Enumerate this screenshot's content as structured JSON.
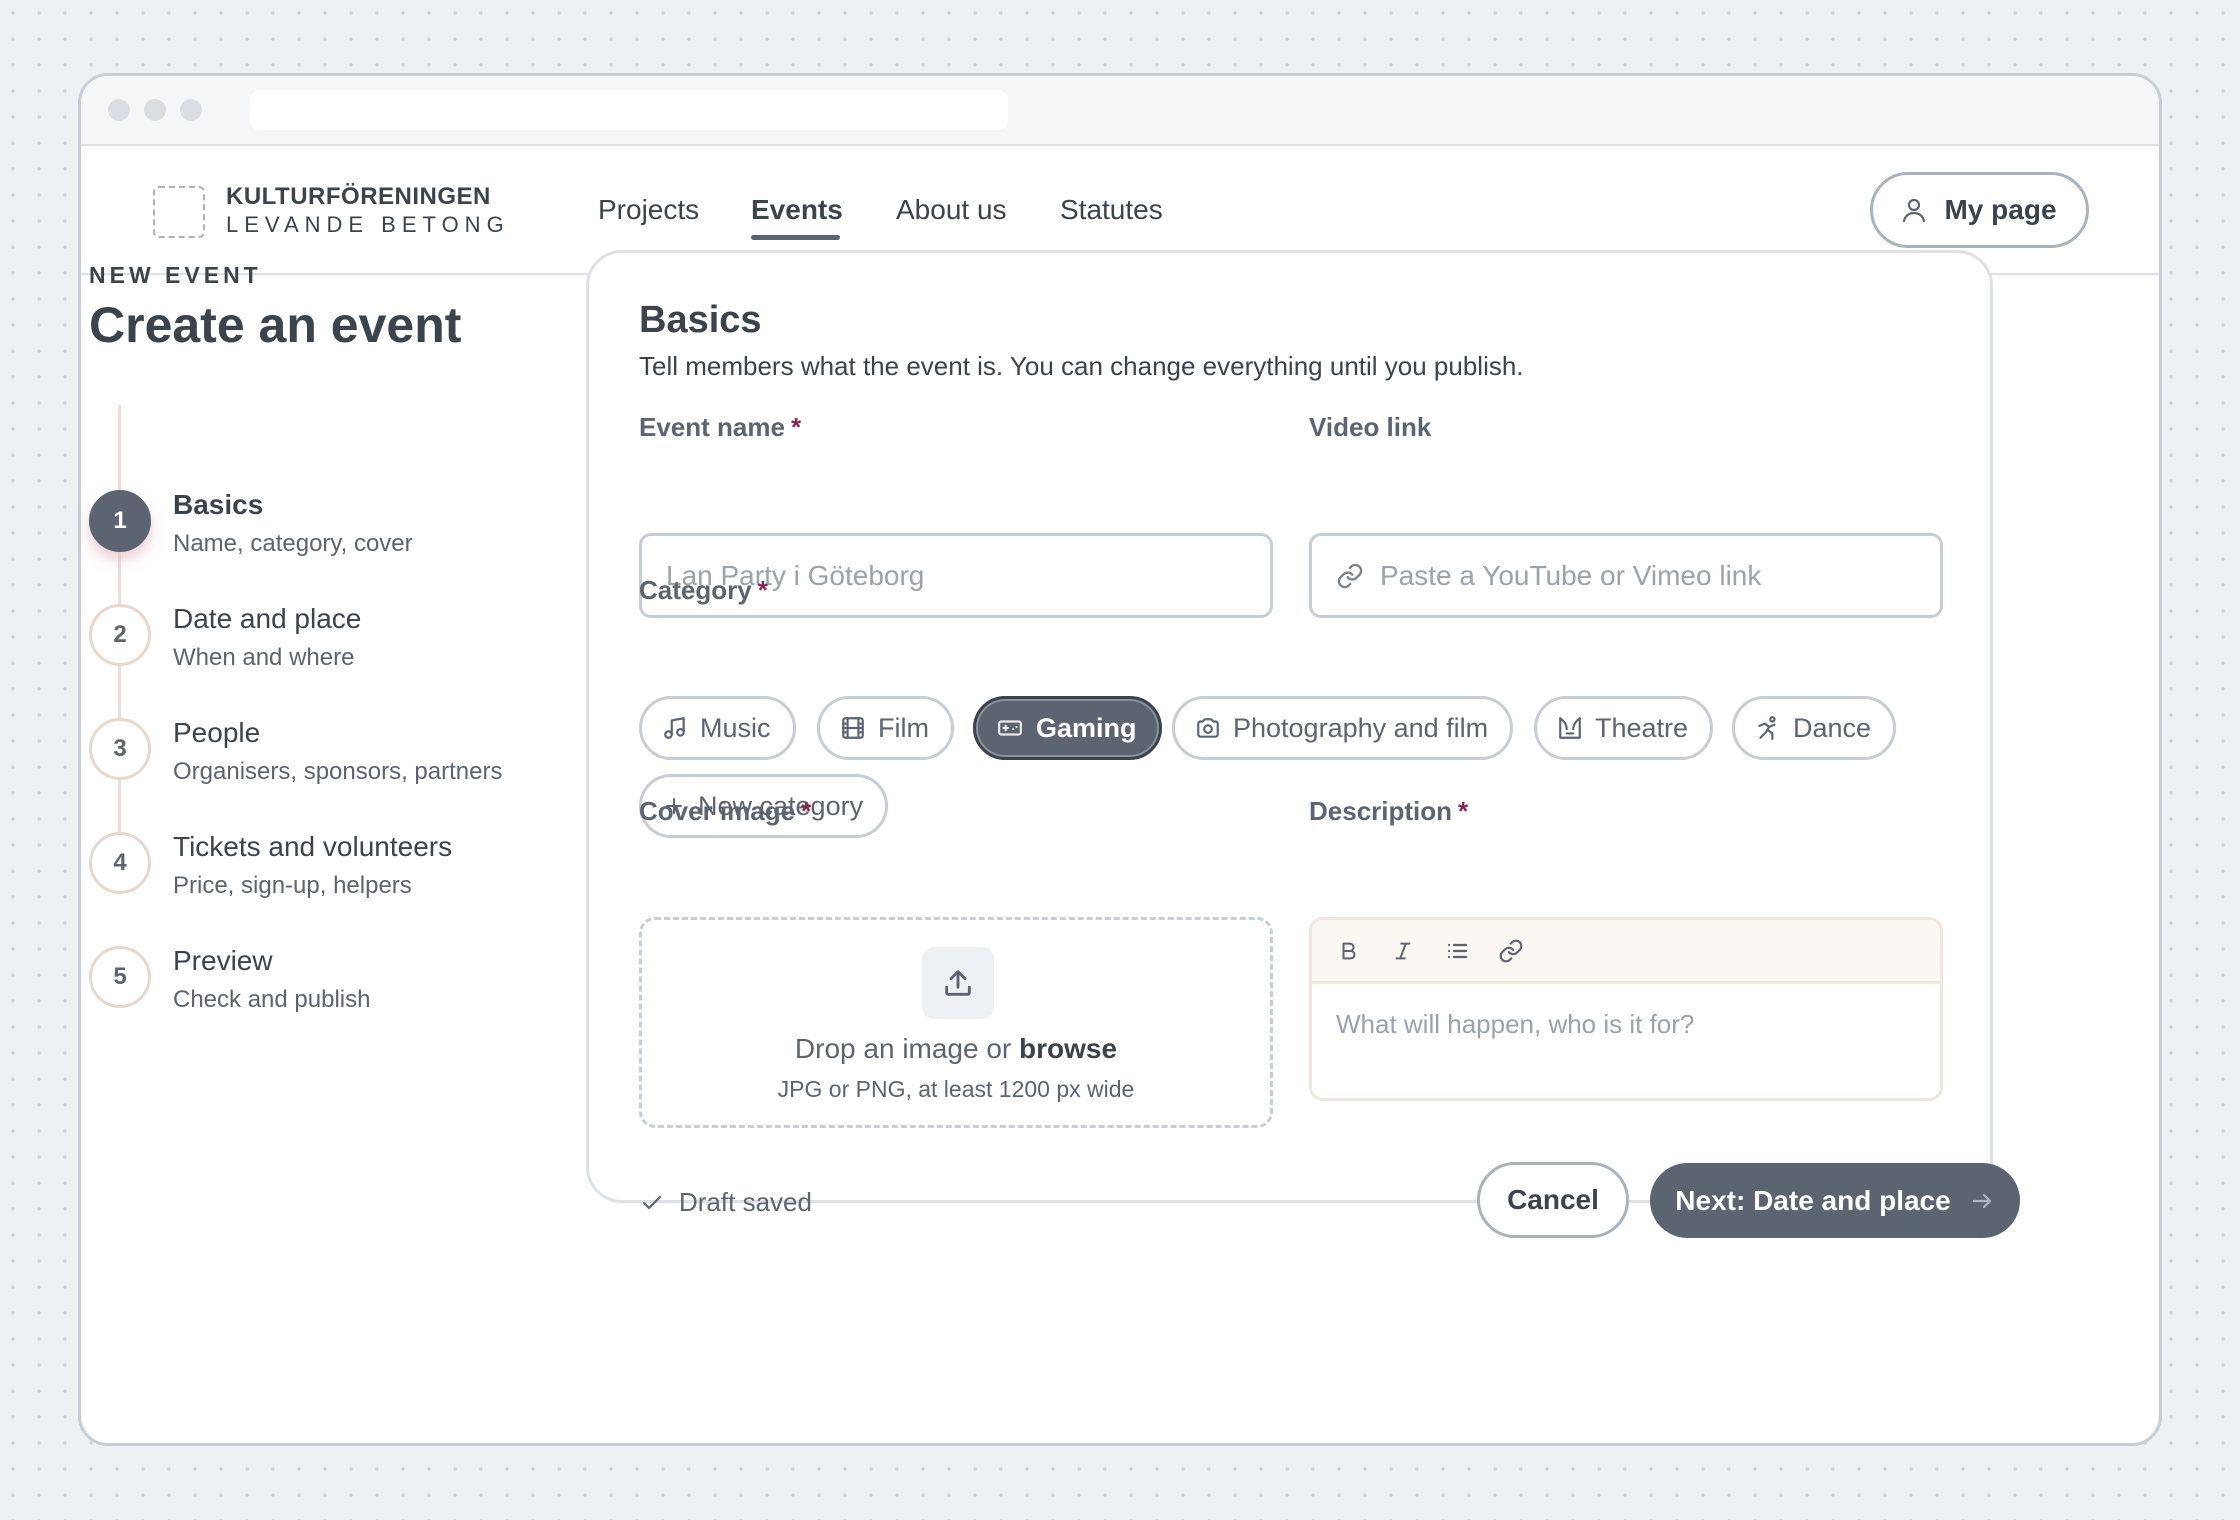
{
  "nav": {
    "logo_line1": "KULTURFÖRENINGEN",
    "logo_line2": "LEVANDE BETONG",
    "links": [
      {
        "label": "Projects",
        "active": false
      },
      {
        "label": "Events",
        "active": true
      },
      {
        "label": "About us",
        "active": false
      },
      {
        "label": "Statutes",
        "active": false
      }
    ],
    "my_page": "My page"
  },
  "page": {
    "eyebrow": "NEW EVENT",
    "title": "Create an event"
  },
  "steps": [
    {
      "number": "1",
      "title": "Basics",
      "subtitle": "Name, category, cover",
      "active": true
    },
    {
      "number": "2",
      "title": "Date and place",
      "subtitle": "When and where",
      "active": false
    },
    {
      "number": "3",
      "title": "People",
      "subtitle": "Organisers, sponsors, partners",
      "active": false
    },
    {
      "number": "4",
      "title": "Tickets and volunteers",
      "subtitle": "Price, sign-up, helpers",
      "active": false
    },
    {
      "number": "5",
      "title": "Preview",
      "subtitle": "Check and publish",
      "active": false
    }
  ],
  "form": {
    "title": "Basics",
    "subtitle": "Tell members what the event is. You can change everything until you publish.",
    "required_mark": "*",
    "event_name": {
      "label": "Event name",
      "placeholder": "Lan Party i Göteborg"
    },
    "video_link": {
      "label": "Video link",
      "placeholder": "Paste a YouTube or Vimeo link",
      "icon": "link-icon"
    },
    "category": {
      "label": "Category",
      "options": [
        {
          "label": "Music",
          "icon": "music-note-icon",
          "selected": false
        },
        {
          "label": "Film",
          "icon": "film-strip-icon",
          "selected": false
        },
        {
          "label": "Gaming",
          "icon": "gamepad-icon",
          "selected": true
        },
        {
          "label": "Photography and film",
          "icon": "camera-icon",
          "selected": false
        },
        {
          "label": "Theatre",
          "icon": "theatre-masks-icon",
          "selected": false
        },
        {
          "label": "Dance",
          "icon": "dancer-icon",
          "selected": false
        }
      ],
      "new_category": "New category"
    },
    "cover_image": {
      "label": "Cover image",
      "drop_text": "Drop an image or",
      "browse": "browse",
      "hint": "JPG or PNG, at least 1200 px wide"
    },
    "description": {
      "label": "Description",
      "placeholder": "What will happen, who is it for?",
      "toolbar": [
        "bold-icon",
        "italic-icon",
        "list-icon",
        "link-icon"
      ]
    },
    "draft_status": "Draft saved",
    "cancel": "Cancel",
    "next": "Next: Date and place"
  },
  "colors": {
    "accent": "#5b6470",
    "required": "#8a2350",
    "step_ring": "#e6d8cd"
  }
}
